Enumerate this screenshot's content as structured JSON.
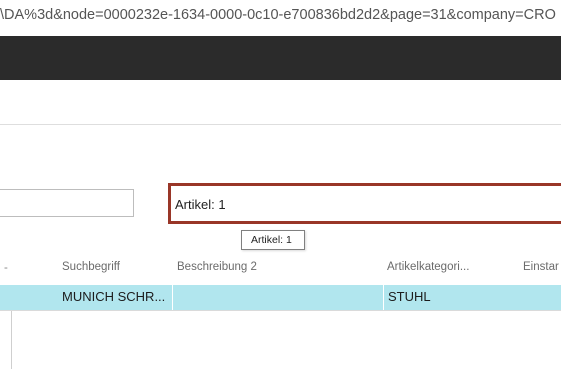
{
  "browser": {
    "url_fragment": "\\DA%3d&node=0000232e-1634-0000-0c10-e700836bd2d2&page=31&company=CRO"
  },
  "filter": {
    "text": "Artikel: 1",
    "tooltip": "Artikel: 1"
  },
  "table": {
    "headers": {
      "col0": "-",
      "suchbegriff": "Suchbegriff",
      "beschreibung2": "Beschreibung 2",
      "artikelkategorie": "Artikelkategori...",
      "einstand": "Einstar"
    },
    "rows": [
      {
        "suchbegriff": "MUNICH SCHR...",
        "beschreibung2": "",
        "artikelkategorie": "STUHL"
      }
    ]
  },
  "colors": {
    "topbar": "#2b2b2b",
    "filter_border": "#993628",
    "selected_row": "#b1e6ee"
  }
}
